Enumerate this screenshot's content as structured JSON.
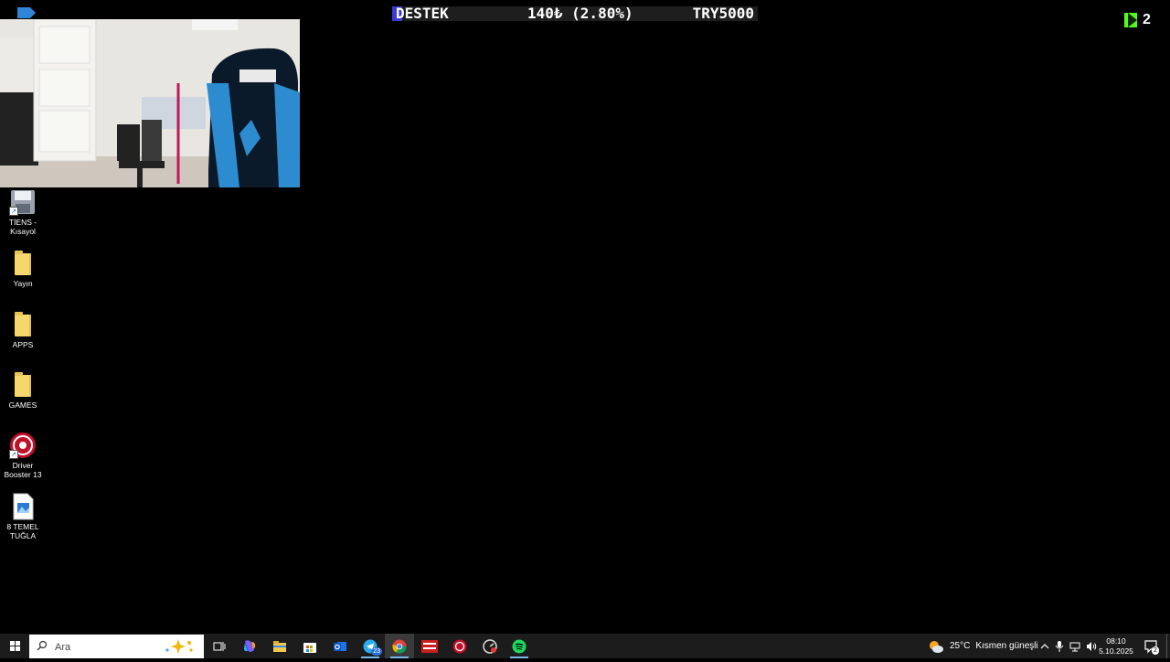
{
  "donation": {
    "label": "DESTEK",
    "amount": "140₺ (2.80%)",
    "goal": "TRY5000",
    "progress_percent": 2.8
  },
  "kick_badge": {
    "count": "2"
  },
  "desktop_icons": [
    {
      "label": "TİENS -\nKısayol"
    },
    {
      "label": "Yayın"
    },
    {
      "label": "APPS"
    },
    {
      "label": "GAMES"
    },
    {
      "label": "Driver\nBooster 13"
    },
    {
      "label": "8 TEMEL\nTUĞLA"
    }
  ],
  "taskbar": {
    "search_placeholder": "Ara",
    "telegram_badge": "23",
    "weather": {
      "temp": "25°C",
      "condition": "Kısmen güneşli"
    },
    "clock": {
      "time": "08:10",
      "date": "5.10.2025"
    },
    "notification_count": "2"
  },
  "colors": {
    "background": "#000000",
    "taskbar": "#1c1c1c",
    "donation_fill": "#3a3ad6",
    "kick_green": "#53fc18",
    "folder": "#f5d76e"
  }
}
